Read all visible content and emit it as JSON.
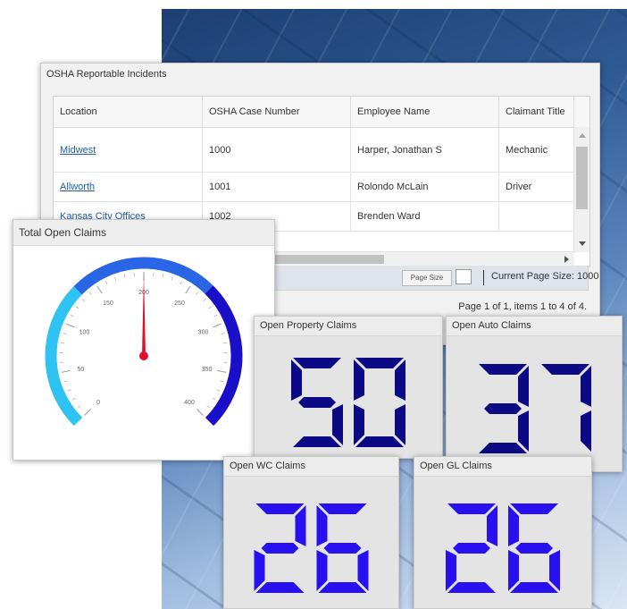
{
  "osha": {
    "title": "OSHA Reportable Incidents",
    "columns": [
      "Location",
      "OSHA Case Number",
      "Employee Name",
      "Claimant Title"
    ],
    "rows": [
      {
        "location": "Midwest",
        "case": "1000",
        "employee": "Harper, Jonathan S",
        "title": "Mechanic"
      },
      {
        "location": "Allworth",
        "case": "1001",
        "employee": "Rolondo McLain",
        "title": "Driver"
      },
      {
        "location": "Kansas City Offices",
        "case": "1002",
        "employee": "Brenden Ward",
        "title": ""
      }
    ],
    "pager": {
      "page_size_button": "Page Size",
      "current_page_size": "Current Page Size: 1000",
      "summary": "Page 1 of 1, items 1 to 4 of 4."
    }
  },
  "gauge": {
    "title": "Total Open Claims",
    "value": 200,
    "min": 0,
    "max": 400,
    "tick_labels": [
      "0",
      "50",
      "100",
      "150",
      "200",
      "250",
      "300",
      "350",
      "400"
    ],
    "colors": {
      "band_low": "#2ec3f2",
      "band_mid": "#2866e6",
      "band_high": "#1a0fc8",
      "needle": "#e0102a"
    }
  },
  "counters": {
    "property": {
      "label": "Open Property Claims",
      "value": "50",
      "color": "#0b0a84"
    },
    "auto": {
      "label": "Open Auto Claims",
      "value": "37",
      "color": "#0b0a84"
    },
    "wc": {
      "label": "Open WC Claims",
      "value": "26",
      "color": "#2810f0"
    },
    "gl": {
      "label": "Open GL Claims",
      "value": "26",
      "color": "#2810f0"
    }
  }
}
